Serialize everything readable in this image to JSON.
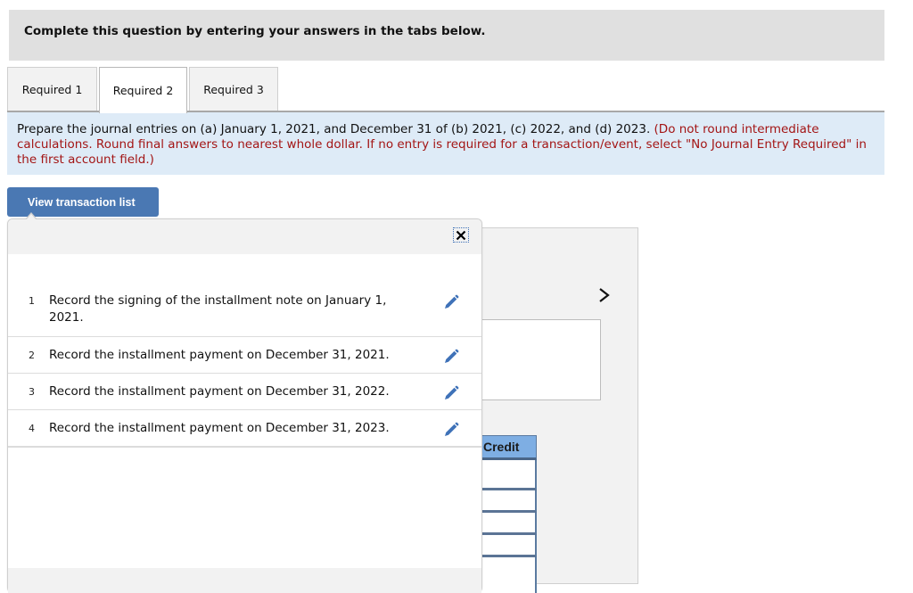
{
  "header": {
    "title": "Complete this question by entering your answers in the tabs below."
  },
  "tabs": [
    {
      "label": "Required 1",
      "active": false
    },
    {
      "label": "Required 2",
      "active": true
    },
    {
      "label": "Required 3",
      "active": false
    }
  ],
  "instructions": {
    "main": "Prepare the journal entries on (a) January 1, 2021, and December 31 of (b) 2021, (c) 2022, and (d) 2023. ",
    "note": "(Do not round intermediate calculations. Round final answers to nearest whole dollar. If no entry is required for a transaction/event, select \"No Journal Entry Required\" in the first account field.)",
    "note_color": "#a31515"
  },
  "view_transaction_list": {
    "label": "View transaction list",
    "color": "#4a78b3"
  },
  "transaction_popup": {
    "close_icon": "close-icon",
    "items": [
      {
        "num": "1",
        "text": "Record the signing of the installment note on January 1, 2021.",
        "icon": "pencil-icon"
      },
      {
        "num": "2",
        "text": "Record the installment payment on December 31, 2021.",
        "icon": "pencil-icon"
      },
      {
        "num": "3",
        "text": "Record the installment payment on December 31, 2022.",
        "icon": "pencil-icon"
      },
      {
        "num": "4",
        "text": "Record the installment payment on December 31, 2023.",
        "icon": "pencil-icon"
      }
    ]
  },
  "journal": {
    "next_icon": "chevron-right-icon",
    "credit_header": "Credit",
    "credit_values": [
      "",
      "",
      "",
      "",
      ""
    ]
  }
}
